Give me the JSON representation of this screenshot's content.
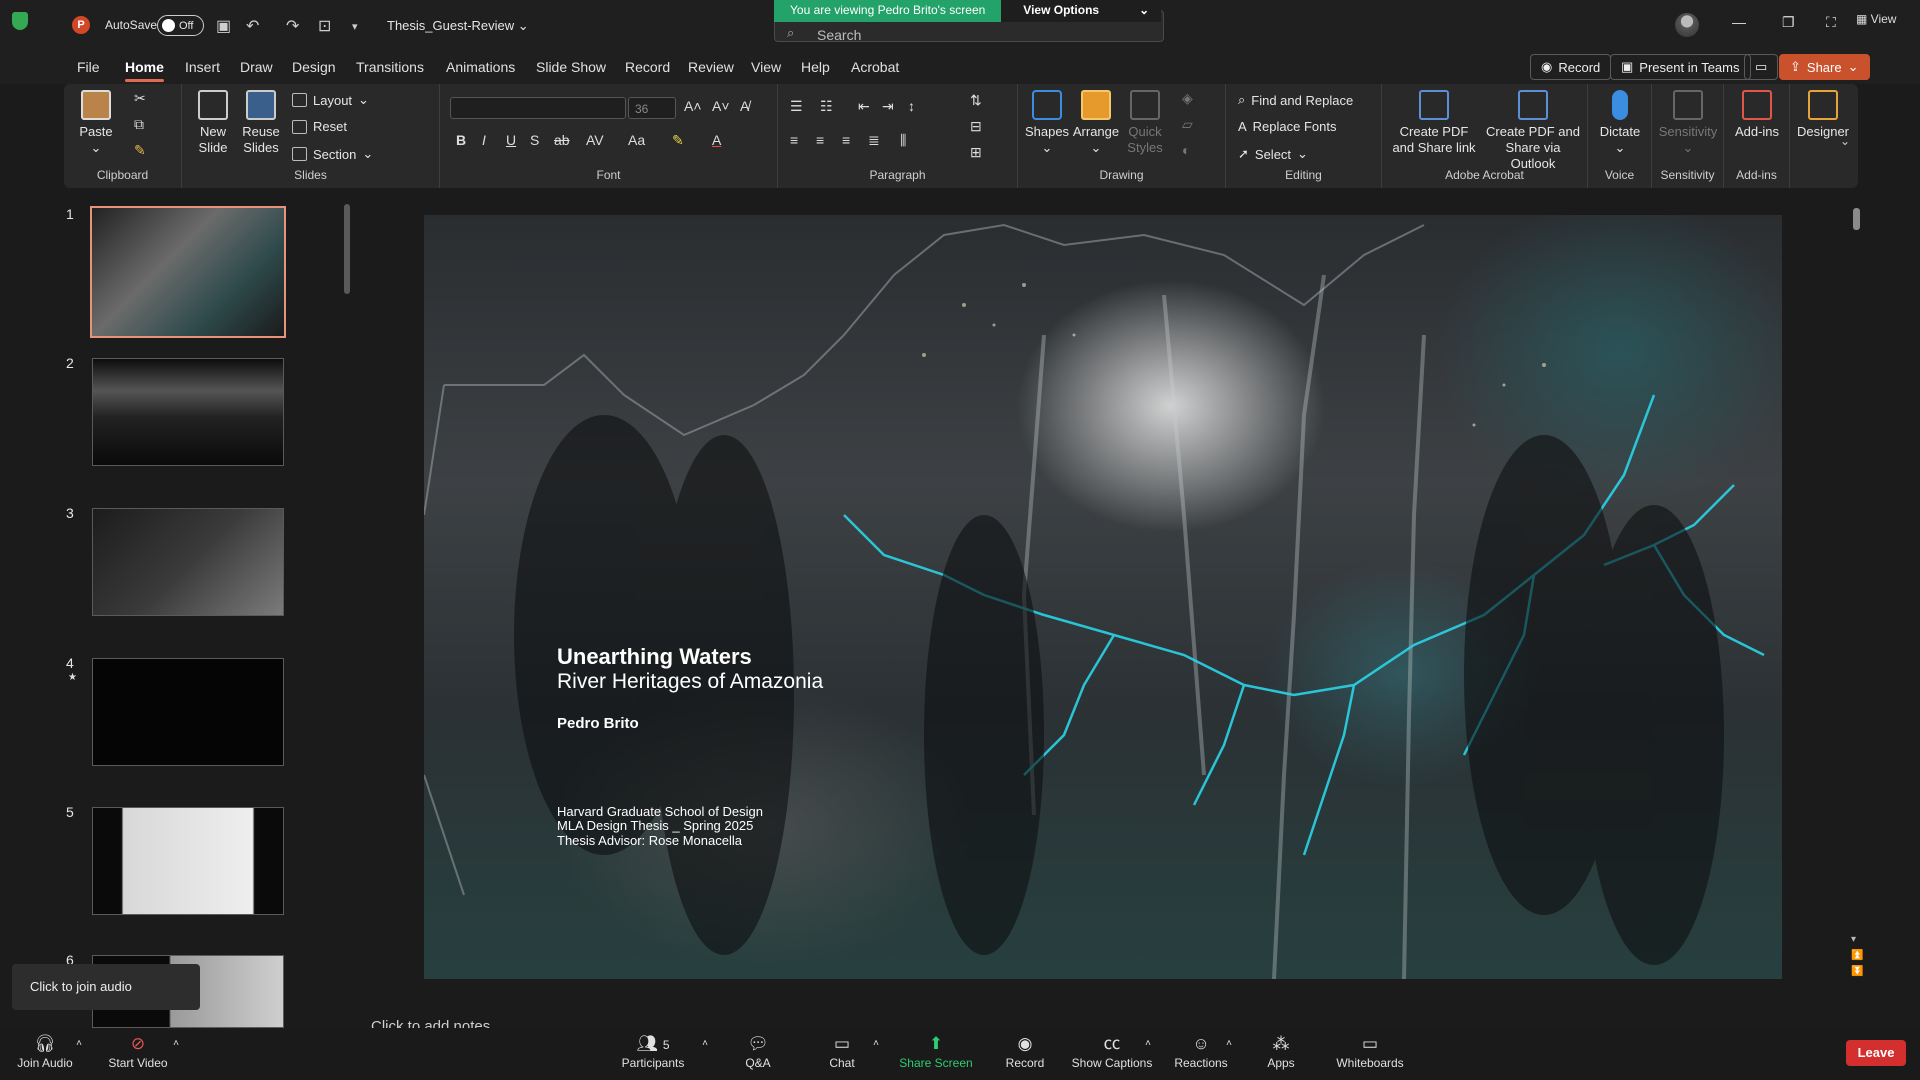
{
  "zoom_banner": {
    "viewing": "You are viewing Pedro Brito's screen",
    "options": "View Options"
  },
  "titlebar": {
    "autosave_label": "AutoSave",
    "autosave_state": "Off",
    "file_name": "Thesis_Guest-Review",
    "search_placeholder": "Search",
    "view_label": "View"
  },
  "menu": {
    "tabs": [
      "File",
      "Home",
      "Insert",
      "Draw",
      "Design",
      "Transitions",
      "Animations",
      "Slide Show",
      "Record",
      "Review",
      "View",
      "Help",
      "Acrobat"
    ],
    "active_tab": "Home",
    "record_btn": "Record",
    "present_btn": "Present in Teams",
    "share_btn": "Share"
  },
  "ribbon": {
    "clipboard": {
      "paste": "Paste",
      "label": "Clipboard"
    },
    "slides": {
      "new_slide": "New Slide",
      "reuse": "Reuse Slides",
      "layout": "Layout",
      "reset": "Reset",
      "section": "Section",
      "label": "Slides"
    },
    "font": {
      "size": "36",
      "label": "Font"
    },
    "paragraph": {
      "label": "Paragraph"
    },
    "drawing": {
      "shapes": "Shapes",
      "arrange": "Arrange",
      "quick_styles": "Quick Styles",
      "label": "Drawing"
    },
    "editing": {
      "find": "Find and Replace",
      "replace_fonts": "Replace Fonts",
      "select": "Select",
      "label": "Editing"
    },
    "acrobat": {
      "create_link": "Create PDF and Share link",
      "create_outlook": "Create PDF and Share via Outlook",
      "label": "Adobe Acrobat"
    },
    "voice": {
      "dictate": "Dictate",
      "label": "Voice"
    },
    "sensitivity": {
      "btn": "Sensitivity",
      "label": "Sensitivity"
    },
    "addins": {
      "btn": "Add-ins",
      "label": "Add-ins"
    },
    "designer": {
      "btn": "Designer"
    }
  },
  "thumbnails": [
    "1",
    "2",
    "3",
    "4",
    "5",
    "6"
  ],
  "slide": {
    "title": "Unearthing Waters",
    "subtitle": "River Heritages of Amazonia",
    "author": "Pedro Brito",
    "school": "Harvard Graduate School of Design",
    "program": "MLA Design Thesis _ Spring 2025",
    "advisor": "Thesis Advisor: Rose Monacella"
  },
  "notes_placeholder": "Click to add notes",
  "zoom_toolbar": {
    "join_audio": "Join Audio",
    "start_video": "Start Video",
    "participants": "Participants",
    "participants_count": "5",
    "qa": "Q&A",
    "chat": "Chat",
    "share_screen": "Share Screen",
    "record": "Record",
    "captions": "Show Captions",
    "reactions": "Reactions",
    "apps": "Apps",
    "whiteboards": "Whiteboards",
    "leave": "Leave"
  },
  "tooltip": "Click to join audio",
  "colors": {
    "accent": "#e06b4e",
    "share": "#c9522d",
    "zoom_green": "#23a36a",
    "leave_red": "#d32f2f",
    "river_cyan": "#2ad4e8"
  }
}
